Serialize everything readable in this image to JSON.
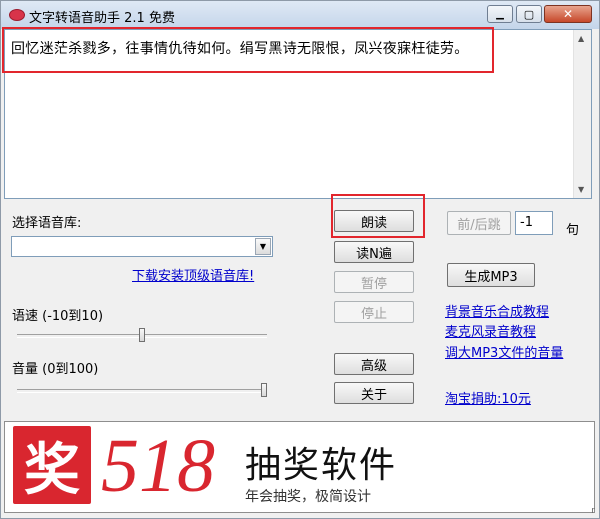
{
  "window": {
    "title": "文字转语音助手 2.1 免费",
    "min_glyph": "▁",
    "max_glyph": "▢",
    "close_glyph": "✕"
  },
  "textarea": {
    "text": "回忆迷茫杀戮多，往事情仇待如何。绢写黑诗无限恨，凤兴夜寐枉徒劳。",
    "scroll_up_glyph": "▲",
    "scroll_down_glyph": "▼"
  },
  "voice": {
    "label": "选择语音库:",
    "selected": "",
    "download_link": "下载安装顶级语音库!"
  },
  "speed": {
    "label": "语速 (-10到10)",
    "value": 0,
    "min": -10,
    "max": 10
  },
  "volume": {
    "label": "音量 (0到100)",
    "value": 100,
    "min": 0,
    "max": 100
  },
  "buttons": {
    "read": "朗读",
    "read_n": "读N遍",
    "pause": "暂停",
    "stop": "停止",
    "advanced": "高级",
    "about": "关于",
    "prev_next": "前/后跳",
    "make_mp3": "生成MP3"
  },
  "jump": {
    "value": "-1",
    "unit": "句"
  },
  "links": {
    "bg_music": "背景音乐合成教程",
    "mic_record": "麦克风录音教程",
    "mp3_volume": "调大MP3文件的音量",
    "donate": "淘宝捐助:10元"
  },
  "banner": {
    "logo_char": "奖",
    "number": "518",
    "product": "抽奖软件",
    "slogan": "年会抽奖，极简设计"
  },
  "status": {
    "grip": "r"
  },
  "colors": {
    "highlight": "#e2262d",
    "link": "#0000cc",
    "brand_red": "#d9262f"
  }
}
